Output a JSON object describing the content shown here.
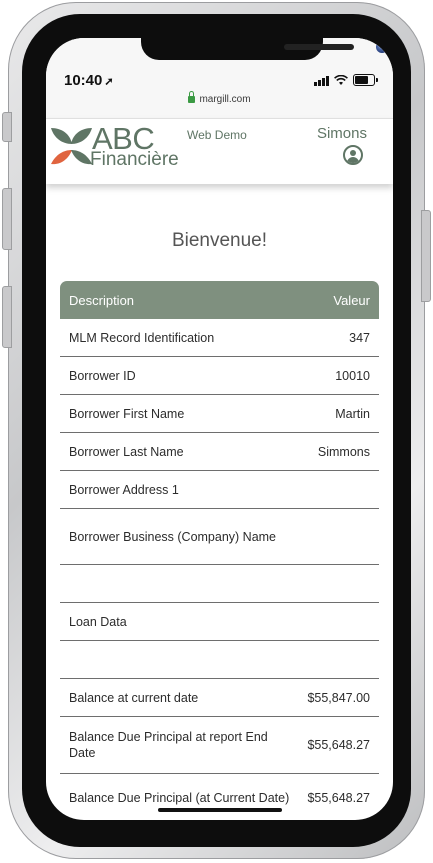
{
  "device": {
    "time": "10:40",
    "url": "margill.com"
  },
  "header": {
    "logo_line1": "ABC",
    "logo_line2": "Financière",
    "web_demo_label": "Web Demo",
    "user_name": "Simons"
  },
  "welcome": "Bienvenue!",
  "table": {
    "header_description": "Description",
    "header_value": "Valeur",
    "rows": [
      {
        "description": "MLM Record Identification",
        "value": "347"
      },
      {
        "description": "Borrower ID",
        "value": "10010"
      },
      {
        "description": "Borrower First Name",
        "value": "Martin"
      },
      {
        "description": "Borrower Last Name",
        "value": "Simmons"
      },
      {
        "description": "Borrower Address 1",
        "value": ""
      },
      {
        "description": "Borrower Business (Company) Name",
        "value": ""
      },
      {
        "description": "",
        "value": ""
      },
      {
        "description": "Loan Data",
        "value": ""
      },
      {
        "description": "",
        "value": ""
      },
      {
        "description": "Balance at current date",
        "value": "$55,847.00"
      },
      {
        "description": "Balance Due Principal at report End Date",
        "value": "$55,648.27"
      },
      {
        "description": "Balance Due Principal (at Current Date)",
        "value": "$55,648.27"
      }
    ]
  },
  "colors": {
    "accent_green": "#5f7565",
    "table_header": "#7f907f",
    "logo_orange": "#e0643f"
  }
}
